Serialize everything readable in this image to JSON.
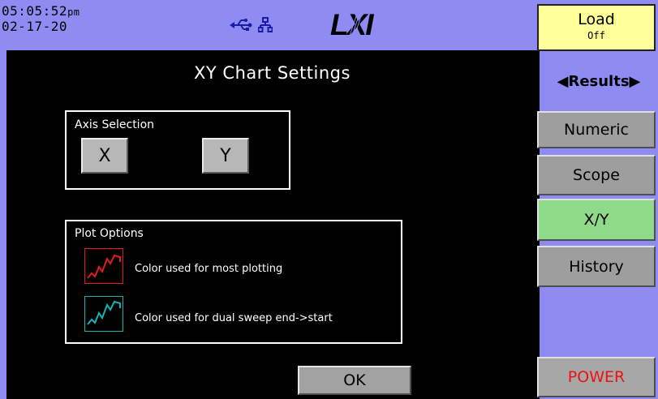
{
  "status": {
    "time": "05:05:52",
    "ampm": "pm",
    "date": "02-17-20",
    "logo_text": "LXI",
    "usb_icon": "usb-icon",
    "lan_icon": "lan-icon"
  },
  "dialog": {
    "title": "XY Chart Settings",
    "axis_group_label": "Axis Selection",
    "axis_x_label": "X",
    "axis_y_label": "Y",
    "plot_group_label": "Plot Options",
    "primary_color_text": "Color used for most plotting",
    "secondary_color_text": "Color used for dual sweep end->start",
    "primary_color": "#e11c1c",
    "secondary_color": "#16b2b4",
    "ok_label": "OK"
  },
  "sidebar": {
    "load_label": "Load",
    "load_state": "Off",
    "results_label": "◀Results▶",
    "numeric_label": "Numeric",
    "scope_label": "Scope",
    "xy_label": "X/Y",
    "history_label": "History",
    "power_label": "POWER"
  },
  "colors": {
    "frame": "#8e8cf2",
    "active_tab": "#8fd98a",
    "load_bg": "#ffff99",
    "power_text": "#ee1111"
  }
}
